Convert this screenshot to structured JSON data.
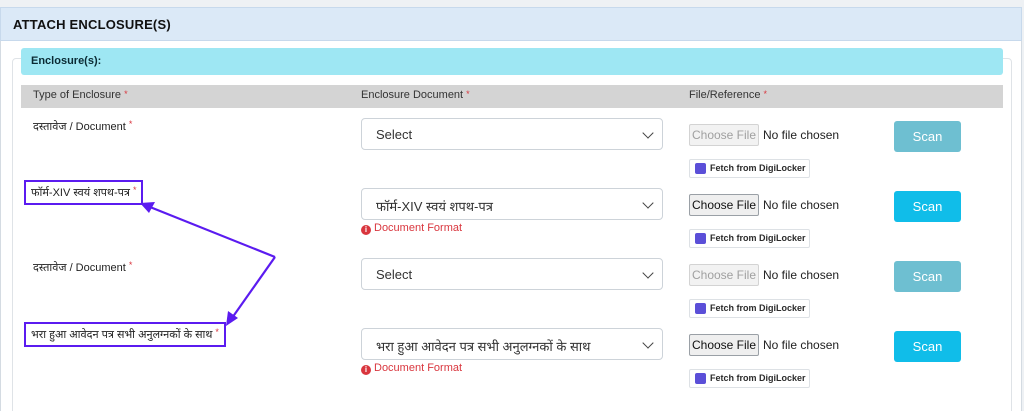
{
  "panel": {
    "title": "ATTACH ENCLOSURE(S)"
  },
  "section": {
    "label": "Enclosure(s):"
  },
  "table": {
    "headers": {
      "type": "Type of Enclosure",
      "document": "Enclosure Document",
      "file": "File/Reference"
    },
    "required_marker": "*"
  },
  "rows": [
    {
      "type_label": "दस्तावेज / Document",
      "select_value": "Select",
      "file_button": "Choose File",
      "file_status": "No file chosen",
      "scan_label": "Scan",
      "digilocker": "Fetch from DigiLocker"
    },
    {
      "type_label": "फॉर्म-XIV स्वयं शपथ-पत्र",
      "select_value": "फॉर्म-XIV स्वयं शपथ-पत्र",
      "doc_format": "Document Format",
      "file_button": "Choose File",
      "file_status": "No file chosen",
      "scan_label": "Scan",
      "digilocker": "Fetch from DigiLocker"
    },
    {
      "type_label": "दस्तावेज / Document",
      "select_value": "Select",
      "file_button": "Choose File",
      "file_status": "No file chosen",
      "scan_label": "Scan",
      "digilocker": "Fetch from DigiLocker"
    },
    {
      "type_label": "भरा हुआ आवेदन पत्र सभी अनुलग्नकों के साथ",
      "select_value": "भरा हुआ आवेदन पत्र सभी अनुलग्नकों के साथ",
      "doc_format": "Document Format",
      "file_button": "Choose File",
      "file_status": "No file chosen",
      "scan_label": "Scan",
      "digilocker": "Fetch from DigiLocker"
    }
  ],
  "icons": [
    "chevron-down-icon",
    "info-icon",
    "digilocker-icon"
  ],
  "colors": {
    "accent": "#10bde9",
    "annotation": "#5b1bf0",
    "required": "#d9363e",
    "section_bar": "#9ee7f3"
  }
}
